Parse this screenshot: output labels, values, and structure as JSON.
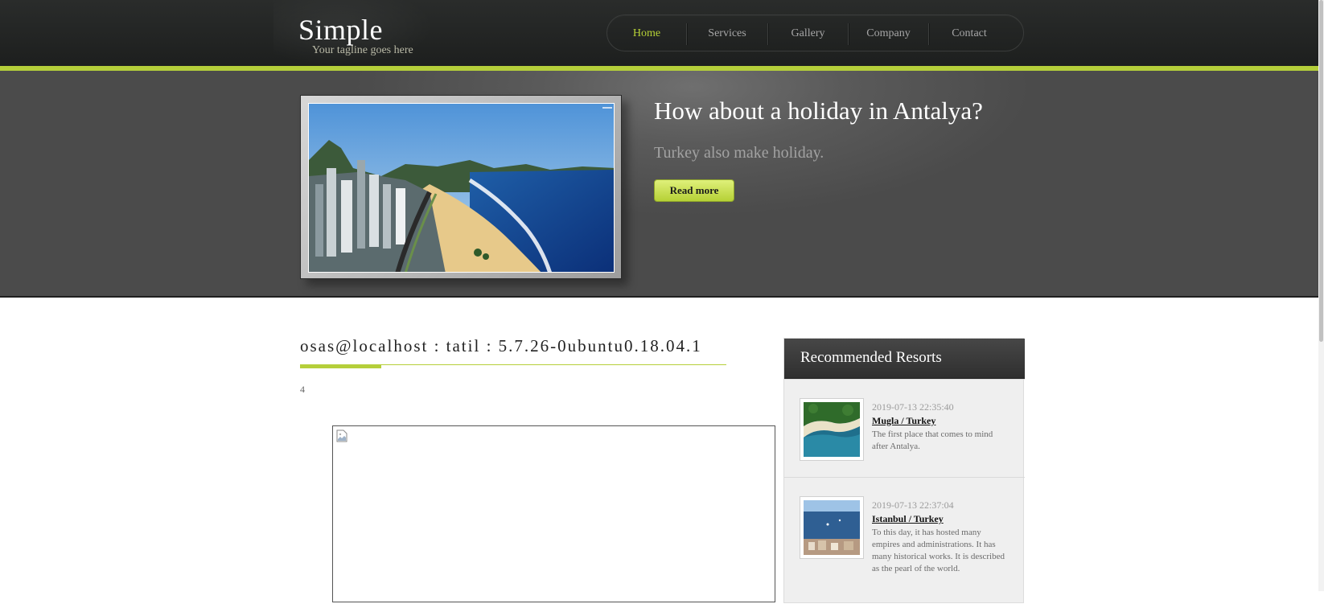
{
  "header": {
    "logo": "Simple",
    "tagline": "Your tagline goes here"
  },
  "nav": {
    "items": [
      {
        "label": "Home",
        "active": true
      },
      {
        "label": "Services",
        "active": false
      },
      {
        "label": "Gallery",
        "active": false
      },
      {
        "label": "Company",
        "active": false
      },
      {
        "label": "Contact",
        "active": false
      }
    ]
  },
  "hero": {
    "title": "How about a holiday in Antalya?",
    "subtitle": "Turkey also make holiday.",
    "button_label": "Read more",
    "image_icon": "beach-photo"
  },
  "main": {
    "title": "osas@localhost : tatil : 5.7.26-0ubuntu0.18.04.1",
    "count": "4",
    "broken_image_icon": "broken-image-icon"
  },
  "sidebar": {
    "title": "Recommended Resorts",
    "items": [
      {
        "date": "2019-07-13 22:35:40",
        "link": "Mugla / Turkey",
        "desc": "The first place that comes to mind after Antalya."
      },
      {
        "date": "2019-07-13 22:37:04",
        "link": "Istanbul / Turkey",
        "desc": "To this day, it has hosted many empires and administrations. It has many historical works. It is described as the pearl of the world."
      }
    ]
  },
  "colors": {
    "accent": "#b5cf3a",
    "header_bg": "#222423",
    "hero_bg": "#555555"
  }
}
